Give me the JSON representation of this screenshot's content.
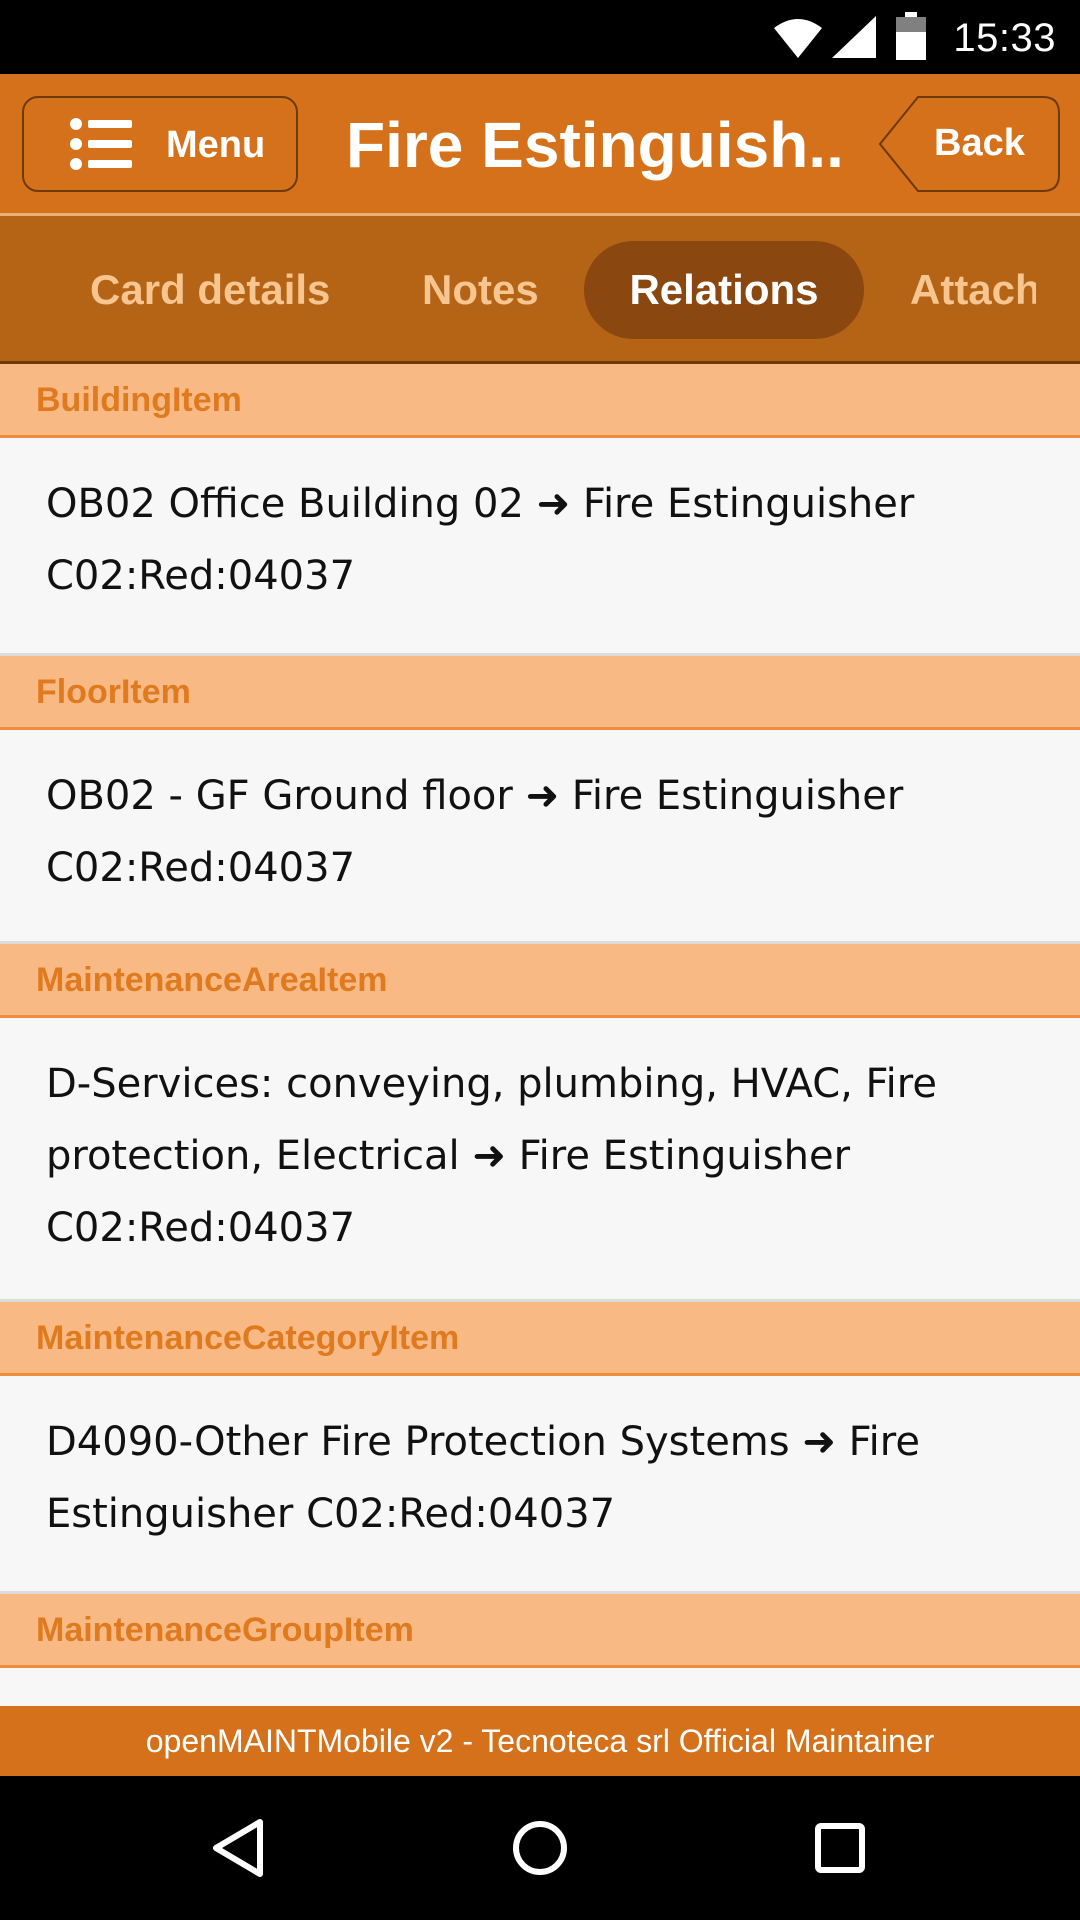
{
  "status_bar": {
    "time": "15:33",
    "icons": [
      "wifi-icon",
      "cell-signal-icon",
      "battery-icon"
    ]
  },
  "header": {
    "menu_label": "Menu",
    "title": "Fire Estinguish...",
    "back_label": "Back"
  },
  "tabs": [
    {
      "label": "Card details",
      "active": false
    },
    {
      "label": "Notes",
      "active": false
    },
    {
      "label": "Relations",
      "active": true
    },
    {
      "label": "Attach",
      "active": false
    }
  ],
  "relations": [
    {
      "group": "BuildingItem",
      "source": "OB02 Office Building 02",
      "target": "Fire Estinguisher C02:Red:04037"
    },
    {
      "group": "FloorItem",
      "source": "OB02 - GF Ground floor",
      "target": "Fire Estinguisher C02:Red:04037"
    },
    {
      "group": "MaintenanceAreaItem",
      "source": "D-Services: conveying, plumbing, HVAC, Fire protection, Electrical",
      "target": "Fire Estinguisher C02:Red:04037"
    },
    {
      "group": "MaintenanceCategoryItem",
      "source": "D4090-Other Fire Protection Systems",
      "target": "Fire Estinguisher C02:Red:04037"
    },
    {
      "group": "MaintenanceGroupItem"
    }
  ],
  "footer": {
    "text": "openMAINTMobile v2 - Tecnoteca srl Official Maintainer"
  },
  "colors": {
    "primary": "#d4711a",
    "tab_bar": "#b56314",
    "tab_active": "#8a4710",
    "section_header_bg": "#f9b985",
    "section_header_text": "#e07a1e"
  }
}
